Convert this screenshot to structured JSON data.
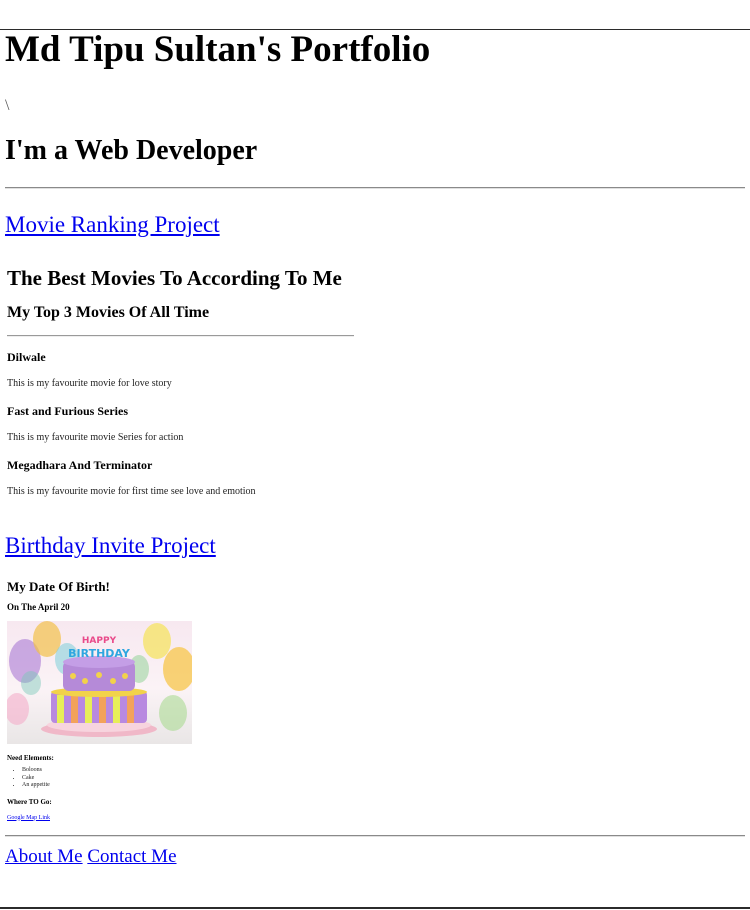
{
  "header": {
    "title": "Md Tipu Sultan's Portfolio",
    "stray_text": "\\",
    "role": "I'm a Web Developer"
  },
  "movie_project": {
    "link_label": "Movie Ranking Project",
    "heading": "The Best Movies To According To Me",
    "subheading": "My Top 3 Movies Of All Time",
    "movies": [
      {
        "name": "Dilwale",
        "description": "This is my favourite movie for love story"
      },
      {
        "name": "Fast and Furious Series",
        "description": "This is my favourite movie Series for action"
      },
      {
        "name": "Megadhara And Terminator",
        "description": "This is my favourite movie for first time see love and emotion"
      }
    ]
  },
  "birthday_project": {
    "link_label": "Birthday Invite Project",
    "heading": "My Date Of Birth!",
    "date": "On The April 20",
    "cake_text": "HAPPY BIRTHDAY",
    "needs_label": "Need Elements:",
    "needs": [
      "Boloons",
      "Cake",
      "An appetite"
    ],
    "where_label": "Where TO Go:",
    "map_link": "Google Map Link"
  },
  "footer": {
    "about_label": "About Me",
    "contact_label": "Contact Me"
  },
  "colors": {
    "link": "#0000ee",
    "rule": "#8a8a8a"
  }
}
